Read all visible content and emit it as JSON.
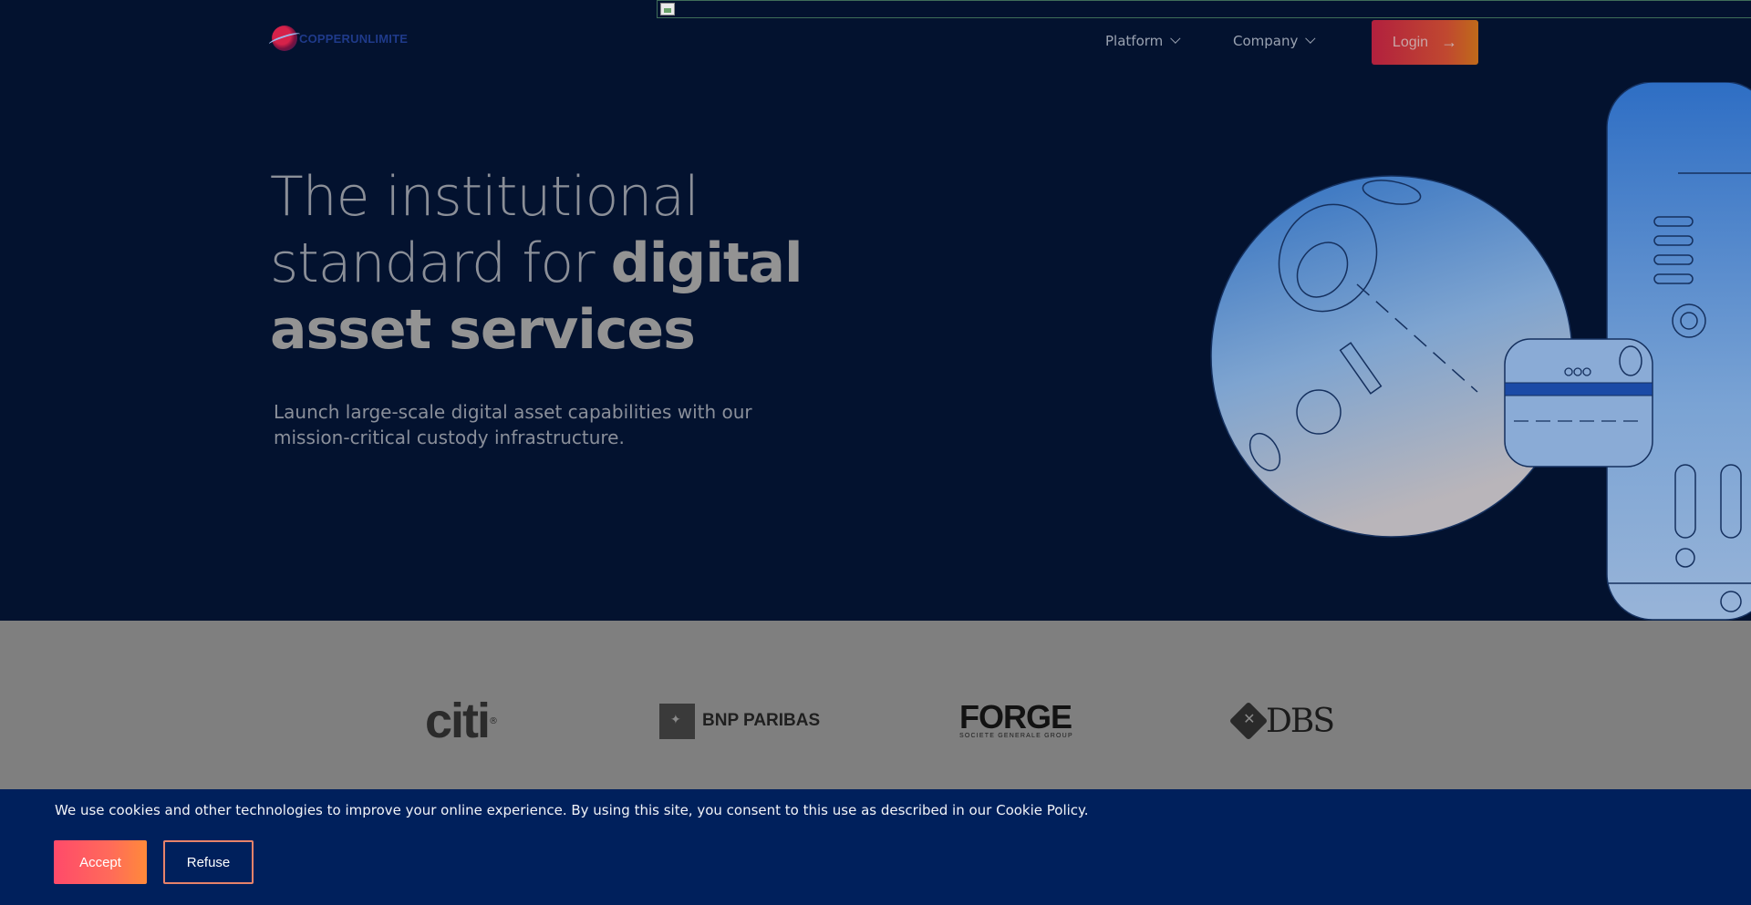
{
  "header": {
    "logo_text": "COPPERUNLIMITE",
    "nav": [
      {
        "label": "Platform"
      },
      {
        "label": "Company"
      }
    ],
    "login_label": "Login"
  },
  "hero": {
    "title_light_1": "The institutional",
    "title_light_2": "standard for ",
    "title_bold_1": "digital",
    "title_bold_2": "asset services",
    "subtitle": "Launch large-scale digital asset capabilities with our mission-critical custody infrastructure."
  },
  "partners": [
    {
      "name": "citi",
      "mark": "®"
    },
    {
      "name": "BNP PARIBAS"
    },
    {
      "name": "FORGE",
      "subtitle": "SOCIETE GENERALE GROUP"
    },
    {
      "name": "DBS"
    }
  ],
  "cookie": {
    "message": "We use cookies and other technologies to improve your online experience. By using this site, you consent to this use as described in our Cookie Policy.",
    "accept_label": "Accept",
    "refuse_label": "Refuse"
  },
  "colors": {
    "hero_bg": "#03122f",
    "partners_bg": "#7f7f7f",
    "cookie_bg": "#00205c",
    "accent": "#ff5a5a"
  }
}
